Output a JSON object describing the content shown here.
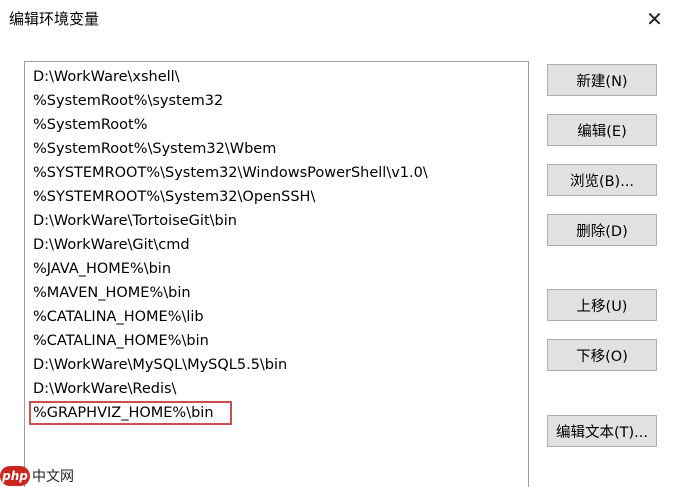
{
  "window": {
    "title": "编辑环境变量",
    "close_glyph": "✕"
  },
  "list": {
    "items": [
      "D:\\WorkWare\\xshell\\",
      "%SystemRoot%\\system32",
      "%SystemRoot%",
      "%SystemRoot%\\System32\\Wbem",
      "%SYSTEMROOT%\\System32\\WindowsPowerShell\\v1.0\\",
      "%SYSTEMROOT%\\System32\\OpenSSH\\",
      "D:\\WorkWare\\TortoiseGit\\bin",
      "D:\\WorkWare\\Git\\cmd",
      "%JAVA_HOME%\\bin",
      "%MAVEN_HOME%\\bin",
      "%CATALINA_HOME%\\lib",
      "%CATALINA_HOME%\\bin",
      "D:\\WorkWare\\MySQL\\MySQL5.5\\bin",
      "D:\\WorkWare\\Redis\\",
      "%GRAPHVIZ_HOME%\\bin"
    ],
    "highlighted_index": 14,
    "highlight_color": "#c9504f"
  },
  "buttons": {
    "new": "新建(N)",
    "edit": "编辑(E)",
    "browse": "浏览(B)...",
    "delete": "删除(D)",
    "move_up": "上移(U)",
    "move_down": "下移(O)",
    "edit_text": "编辑文本(T)..."
  },
  "watermark": {
    "badge": "php",
    "text": "中文网"
  }
}
